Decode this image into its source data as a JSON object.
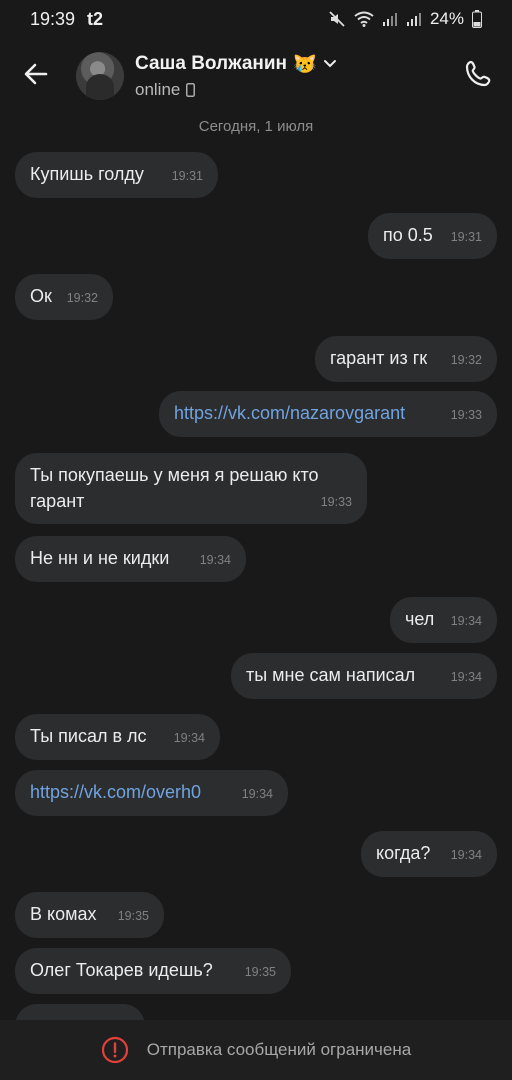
{
  "status_bar": {
    "time": "19:39",
    "carrier": "t2",
    "battery": "24%"
  },
  "header": {
    "name": "Саша Волжанин",
    "emoji": "😿",
    "status": "online"
  },
  "date_separator": "Сегодня, 1 июля",
  "messages": [
    {
      "side": "in",
      "text": "Купишь голду",
      "time": "19:31"
    },
    {
      "side": "out",
      "text": "по 0.5",
      "time": "19:31"
    },
    {
      "side": "in",
      "text": "Ок",
      "time": "19:32"
    },
    {
      "side": "out",
      "text": "гарант из гк",
      "time": "19:32"
    },
    {
      "side": "out",
      "text": "https://vk.com/nazarovgarant",
      "time": "19:33",
      "is_link": true
    },
    {
      "side": "in",
      "text": "Ты покупаешь у меня я решаю кто",
      "text2": "гарант",
      "time": "19:33"
    },
    {
      "side": "in",
      "text": "Не нн и не кидки",
      "time": "19:34"
    },
    {
      "side": "out",
      "text": "чел",
      "time": "19:34"
    },
    {
      "side": "out",
      "text": "ты мне сам написал",
      "time": "19:34"
    },
    {
      "side": "in",
      "text": "Ты писал в лс",
      "time": "19:34"
    },
    {
      "side": "in",
      "text": "https://vk.com/overh0",
      "time": "19:34",
      "is_link": true
    },
    {
      "side": "out",
      "text": "когда?",
      "time": "19:34"
    },
    {
      "side": "in",
      "text": "В комах",
      "time": "19:35"
    },
    {
      "side": "in",
      "text": "Олег Токарев идешь?",
      "time": "19:35"
    }
  ],
  "bottom_notice": "Отправка сообщений ограничена",
  "colors": {
    "background": "#191919",
    "bubble": "#2c2d2f",
    "link": "#70a3e0",
    "warning": "#e2413b"
  }
}
